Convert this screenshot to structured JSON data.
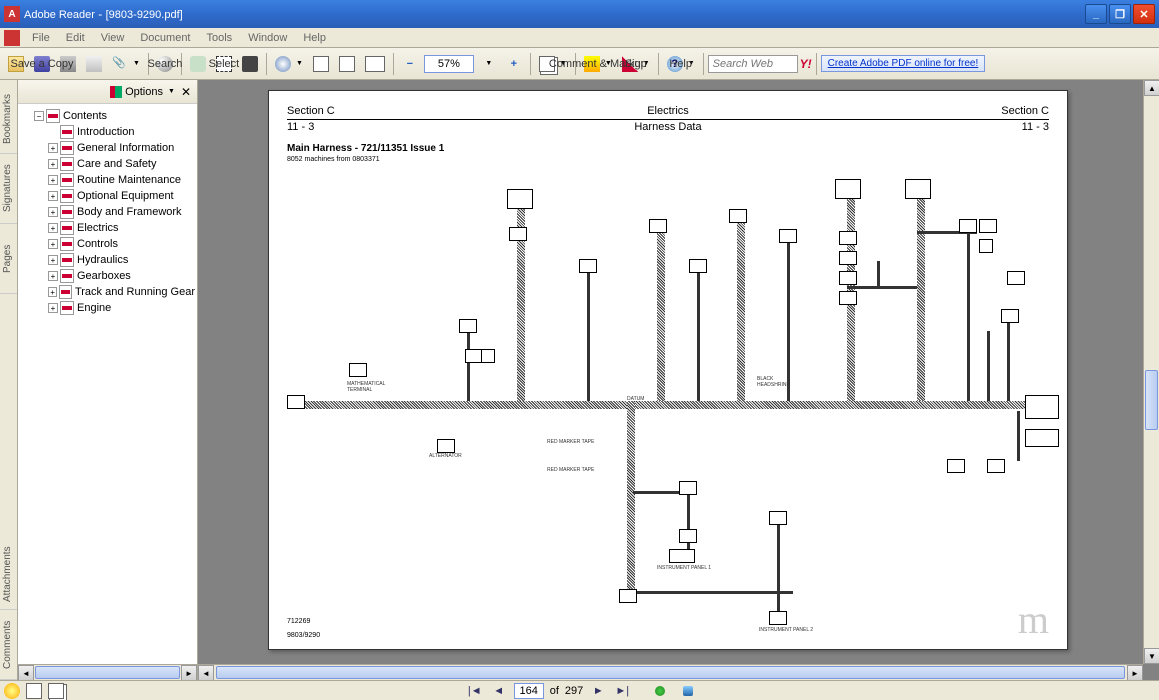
{
  "window": {
    "app": "Adobe Reader",
    "filename": "[9803-9290.pdf]"
  },
  "menu": [
    "File",
    "Edit",
    "View",
    "Document",
    "Tools",
    "Window",
    "Help"
  ],
  "toolbar": {
    "save": "Save a Copy",
    "search": "Search",
    "select": "Select",
    "zoom": "57%",
    "comment": "Comment & Markup",
    "sign": "Sign",
    "help": "Help",
    "search_web_placeholder": "Search Web",
    "adobe_link": "Create Adobe PDF online for free!"
  },
  "bookmarks": {
    "options": "Options",
    "root": "Contents",
    "items": [
      "Introduction",
      "General Information",
      "Care and Safety",
      "Routine Maintenance",
      "Optional Equipment",
      "Body and Framework",
      "Electrics",
      "Controls",
      "Hydraulics",
      "Gearboxes",
      "Track and Running Gear",
      "Engine"
    ]
  },
  "sidetabs": [
    "Bookmarks",
    "Signatures",
    "Pages",
    "Attachments",
    "Comments"
  ],
  "document": {
    "section_left": "Section C",
    "section_center": "Electrics",
    "section_right": "Section C",
    "pageno_left": "11 - 3",
    "pageno_center": "Harness Data",
    "pageno_right": "11 - 3",
    "title": "Main Harness - 721/11351 Issue 1",
    "subtitle": "8052 machines from 0803371",
    "footer_ref": "712269",
    "footer_doc": "9803/9290",
    "watermark": "m"
  },
  "pagenav": {
    "current": "164",
    "total": "297",
    "of": "of"
  }
}
